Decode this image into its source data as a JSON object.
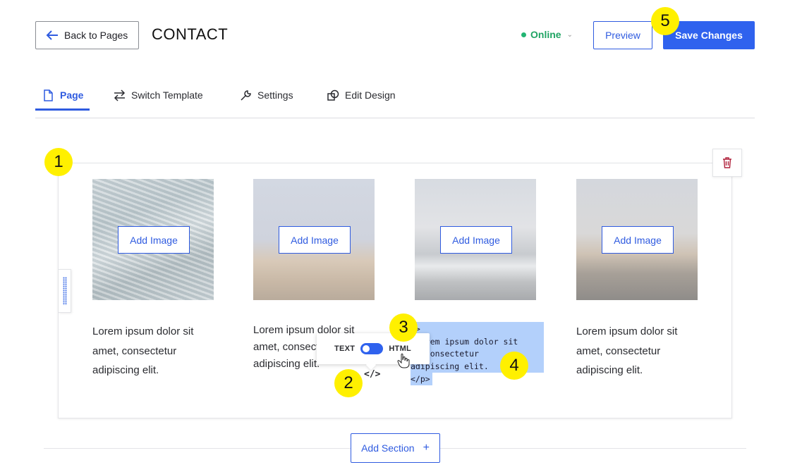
{
  "header": {
    "back_label": "Back to Pages",
    "page_title": "CONTACT",
    "status_label": "Online",
    "preview_label": "Preview",
    "save_label": "Save Changes"
  },
  "tabs": [
    {
      "label": "Page",
      "icon": "page-icon",
      "active": true
    },
    {
      "label": "Switch Template",
      "icon": "swap-arrows-icon",
      "active": false
    },
    {
      "label": "Settings",
      "icon": "wrench-icon",
      "active": false
    },
    {
      "label": "Edit Design",
      "icon": "shapes-icon",
      "active": false
    }
  ],
  "section": {
    "columns": [
      {
        "add_image_label": "Add Image",
        "caption": "Lorem ipsum dolor sit amet, consectetur adipiscing elit."
      },
      {
        "add_image_label": "Add Image",
        "caption": "Lorem ipsum dolor sit amet, consectetur adipiscing elit."
      },
      {
        "add_image_label": "Add Image",
        "caption": ""
      },
      {
        "add_image_label": "Add Image",
        "caption": "Lorem ipsum dolor sit amet, consectetur adipiscing elit."
      }
    ],
    "html_editor": {
      "line1": "p>",
      "line2": " Lorem ipsum dolor sit",
      "line3": "a, consectetur",
      "line4": "adipiscing elit.",
      "closing_tag": "</p>"
    }
  },
  "toggle": {
    "text_label": "TEXT",
    "html_label": "HTML",
    "code_icon_glyph": "</>"
  },
  "callouts": [
    "1",
    "2",
    "3",
    "4",
    "5"
  ],
  "footer": {
    "add_section_label": "Add Section",
    "add_section_icon": "+"
  },
  "colors": {
    "accent": "#2f62ee",
    "status_online": "#22b573",
    "callout": "#fff000",
    "html_highlight": "#b3d0fb",
    "trash": "#b0213b"
  }
}
